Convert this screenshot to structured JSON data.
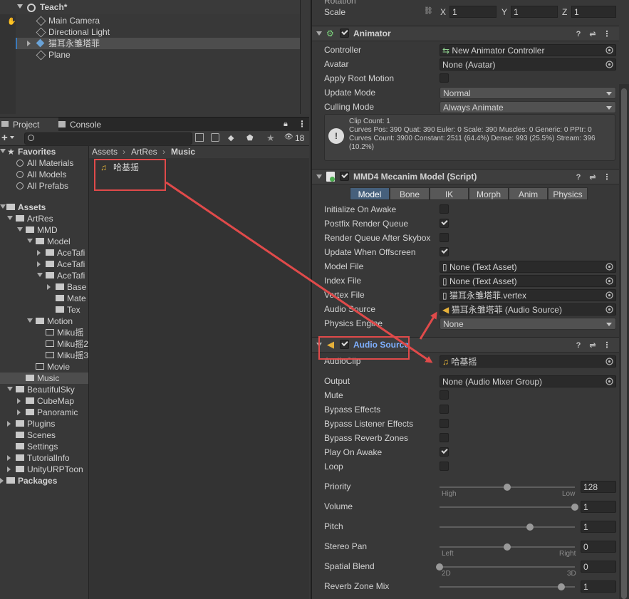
{
  "hierarchy": {
    "scene_name": "Teach*",
    "items": [
      "Main Camera",
      "Directional Light",
      "猫耳永雏塔菲",
      "Plane"
    ]
  },
  "project_window": {
    "tabs": [
      "Project",
      "Console"
    ],
    "badge_count": "18",
    "favorites": {
      "label": "Favorites",
      "items": [
        "All Materials",
        "All Models",
        "All Prefabs"
      ]
    },
    "assets_label": "Assets",
    "tree": {
      "artres": "ArtRes",
      "mmd": "MMD",
      "model": "Model",
      "acetafi1": "AceTafi",
      "acetafi2": "AceTafi",
      "acetafi3": "AceTafi",
      "base": "Base",
      "mate": "Mate",
      "tex": "Tex",
      "motion": "Motion",
      "miku1": "Miku摇",
      "miku2": "Miku摇2",
      "miku3": "Miku摇3",
      "movie": "Movie",
      "music": "Music",
      "beautifulsky": "BeautifulSky",
      "cubemap": "CubeMap",
      "panoramic": "Panoramic",
      "plugins": "Plugins",
      "scenes": "Scenes",
      "settings": "Settings",
      "tutorialinfo": "TutorialInfo",
      "unityurptoon": "UnityURPToon",
      "packages": "Packages"
    },
    "breadcrumb": [
      "Assets",
      "ArtRes",
      "Music"
    ],
    "asset_file": "哈基摇"
  },
  "inspector": {
    "transform": {
      "rotation_label": "Rotation",
      "scale_label": "Scale",
      "scale": {
        "x": "1",
        "y": "1",
        "z": "1"
      }
    },
    "animator": {
      "title": "Animator",
      "fields": {
        "controller": {
          "label": "Controller",
          "value": "New Animator Controller"
        },
        "avatar": {
          "label": "Avatar",
          "value": "None (Avatar)"
        },
        "apply_root_motion": {
          "label": "Apply Root Motion",
          "checked": false
        },
        "update_mode": {
          "label": "Update Mode",
          "value": "Normal"
        },
        "culling_mode": {
          "label": "Culling Mode",
          "value": "Always Animate"
        }
      },
      "info": "Clip Count: 1\nCurves Pos: 390 Quat: 390 Euler: 0 Scale: 390 Muscles: 0 Generic: 0 PPtr: 0\nCurves Count: 3900 Constant: 2511 (64.4%) Dense: 993 (25.5%) Stream: 396\n(10.2%)"
    },
    "mmd4": {
      "title": "MMD4 Mecanim Model (Script)",
      "tabs": [
        "Model",
        "Bone",
        "IK",
        "Morph",
        "Anim",
        "Physics"
      ],
      "active_tab": "Model",
      "toggles": [
        {
          "label": "Initialize On Awake",
          "checked": false
        },
        {
          "label": "Postfix Render Queue",
          "checked": true
        },
        {
          "label": "Render Queue After Skybox",
          "checked": false
        },
        {
          "label": "Update When Offscreen",
          "checked": true
        }
      ],
      "model_file": {
        "label": "Model File",
        "value": "None (Text Asset)"
      },
      "index_file": {
        "label": "Index File",
        "value": "None (Text Asset)"
      },
      "vertex_file": {
        "label": "Vertex File",
        "value": "猫耳永雏塔菲.vertex"
      },
      "audio_source": {
        "label": "Audio Source",
        "value": "猫耳永雏塔菲 (Audio Source)"
      },
      "physics_engine": {
        "label": "Physics Engine",
        "value": "None"
      }
    },
    "audio_source": {
      "title": "Audio Source",
      "audio_clip": {
        "label": "AudioClip",
        "value": "哈基摇"
      },
      "output": {
        "label": "Output",
        "value": "None (Audio Mixer Group)"
      },
      "toggles": [
        {
          "label": "Mute",
          "checked": false
        },
        {
          "label": "Bypass Effects",
          "checked": false
        },
        {
          "label": "Bypass Listener Effects",
          "checked": false
        },
        {
          "label": "Bypass Reverb Zones",
          "checked": false
        },
        {
          "label": "Play On Awake",
          "checked": true
        },
        {
          "label": "Loop",
          "checked": false
        }
      ],
      "sliders": [
        {
          "label": "Priority",
          "value": "128",
          "fraction": 0.5,
          "min_label": "High",
          "max_label": "Low"
        },
        {
          "label": "Volume",
          "value": "1",
          "fraction": 1.0
        },
        {
          "label": "Pitch",
          "value": "1",
          "fraction": 0.67
        },
        {
          "label": "Stereo Pan",
          "value": "0",
          "fraction": 0.5,
          "min_label": "Left",
          "max_label": "Right"
        },
        {
          "label": "Spatial Blend",
          "value": "0",
          "fraction": 0.0,
          "min_label": "2D",
          "max_label": "3D"
        },
        {
          "label": "Reverb Zone Mix",
          "value": "1",
          "fraction": 0.9
        }
      ]
    }
  },
  "colors": {
    "annotation": "#e04a4a",
    "selection": "#2c5d87",
    "highlight_title": "#7fb0ff"
  }
}
